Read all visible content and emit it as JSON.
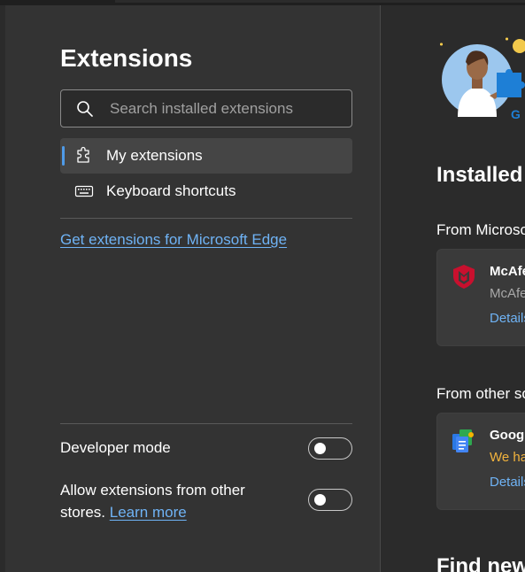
{
  "sidebar": {
    "title": "Extensions",
    "search": {
      "placeholder": "Search installed extensions",
      "icon": "search-icon"
    },
    "nav": [
      {
        "label": "My extensions",
        "icon": "puzzle-icon",
        "active": true
      },
      {
        "label": "Keyboard shortcuts",
        "icon": "keyboard-icon",
        "active": false
      }
    ],
    "get_extensions_link": "Get extensions for Microsoft Edge",
    "developer_mode": {
      "label": "Developer mode",
      "on": false
    },
    "allow_other_stores": {
      "label": "Allow extensions from other stores.",
      "learn_more": "Learn more",
      "on": false
    }
  },
  "main": {
    "installed_heading": "Installed",
    "sections": [
      {
        "label": "From Microso",
        "cards": [
          {
            "name": "McAfe",
            "subtitle": "McAfe",
            "details": "Details",
            "icon": "mcafee-shield-icon",
            "subtitle_warning": false
          }
        ]
      },
      {
        "label": "From other so",
        "cards": [
          {
            "name": "Googl",
            "subtitle": "We ha",
            "details": "Details",
            "icon": "google-docs-icon",
            "subtitle_warning": true
          }
        ]
      }
    ],
    "find_heading": "Find new"
  },
  "colors": {
    "accent": "#4f9be8",
    "link": "#6fb3f5",
    "warning": "#f2b33d",
    "sidebar_bg": "#333333",
    "page_bg": "#2b2b2b"
  }
}
